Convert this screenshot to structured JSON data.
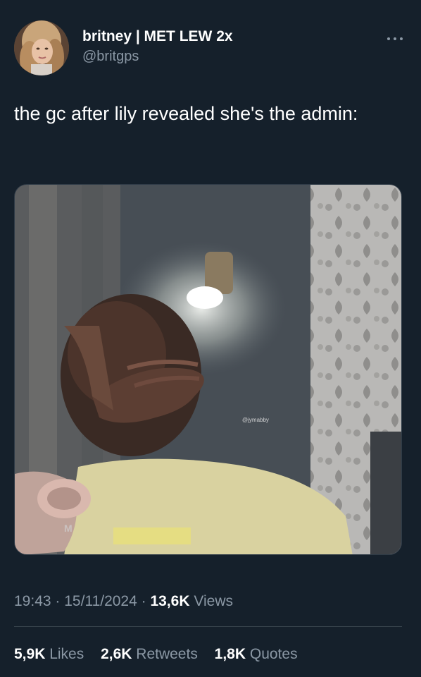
{
  "author": {
    "display_name": "britney | MET LEW 2x",
    "handle": "@britgps"
  },
  "tweet": {
    "text": "the gc after lily revealed she's the admin:",
    "media_watermark": "@jymabby",
    "time": "19:43",
    "date": "15/11/2024",
    "separator": "·",
    "views_count": "13,6K",
    "views_label": "Views"
  },
  "stats": [
    {
      "count": "5,9K",
      "label": "Likes"
    },
    {
      "count": "2,6K",
      "label": "Retweets"
    },
    {
      "count": "1,8K",
      "label": "Quotes"
    }
  ],
  "icons": {
    "more": "more-horizontal-icon"
  },
  "colors": {
    "background": "#15202b",
    "primary_text": "#ffffff",
    "secondary_text": "#8b98a5",
    "divider": "#38444d"
  }
}
